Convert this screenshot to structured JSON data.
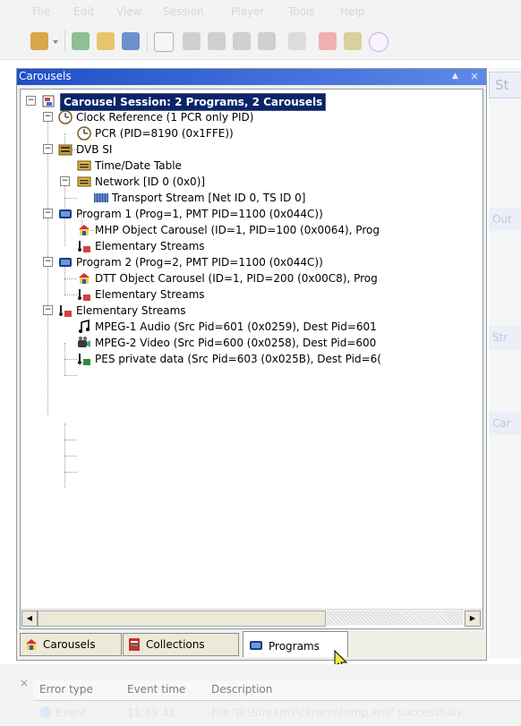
{
  "menu": [
    "File",
    "Edit",
    "View",
    "Session",
    "Player",
    "Tools",
    "Help"
  ],
  "toolbar": {
    "icons": [
      "new-carousel-icon",
      "dropdown-arrow-icon",
      "new-item-icon",
      "open-folder-icon",
      "save-icon",
      "window-icon",
      "play-icon",
      "pause-icon",
      "stop-icon",
      "record-icon",
      "settings-icon",
      "plugin-icon",
      "media-icon",
      "ts-icon"
    ]
  },
  "panel": {
    "title": "Carousels",
    "pin": "▲",
    "close": "×"
  },
  "tree": [
    {
      "label": "Carousel Session: 2 Programs, 2 Carousels",
      "icon": "session-icon",
      "level": 0,
      "expand": "−",
      "selected": true
    },
    {
      "label": "Clock Reference (1 PCR only PID)",
      "icon": "clock-icon",
      "level": 1,
      "expand": "−"
    },
    {
      "label": "PCR (PID=8190 (0x1FFE))",
      "icon": "clock-icon",
      "level": 2
    },
    {
      "label": "DVB SI",
      "icon": "dvb-si-icon",
      "level": 1,
      "expand": "−"
    },
    {
      "label": "Time/Date Table",
      "icon": "table-icon",
      "level": 2
    },
    {
      "label": "Network [ID 0 (0x0)]",
      "icon": "table-icon",
      "level": 2,
      "expand": "−"
    },
    {
      "label": "Transport Stream [Net ID 0, TS ID 0]",
      "icon": "transport-stream-icon",
      "level": 3
    },
    {
      "label": "Program 1 (Prog=1, PMT PID=1100 (0x044C))",
      "icon": "program-icon",
      "level": 1,
      "expand": "−"
    },
    {
      "label": "MHP Object Carousel (ID=1, PID=100 (0x0064), Prog",
      "icon": "carousel-icon",
      "level": 2
    },
    {
      "label": "Elementary Streams",
      "icon": "streams-icon",
      "level": 2
    },
    {
      "label": "Program 2 (Prog=2, PMT PID=1100 (0x044C))",
      "icon": "program-icon",
      "level": 1,
      "expand": "−"
    },
    {
      "label": "DTT Object Carousel (ID=1, PID=200 (0x00C8), Prog",
      "icon": "carousel-icon",
      "level": 2
    },
    {
      "label": "Elementary Streams",
      "icon": "streams-icon",
      "level": 2
    },
    {
      "label": "Elementary Streams",
      "icon": "streams-icon",
      "level": 1,
      "expand": "−"
    },
    {
      "label": "MPEG-1 Audio (Src Pid=601 (0x0259), Dest Pid=601",
      "icon": "audio-icon",
      "level": 2
    },
    {
      "label": "MPEG-2 Video (Src Pid=600 (0x0258), Dest Pid=600",
      "icon": "video-icon",
      "level": 2
    },
    {
      "label": "PES private data (Src Pid=603 (0x025B), Dest Pid=6(",
      "icon": "pes-data-icon",
      "level": 2
    }
  ],
  "scroll": {
    "left": "◀",
    "right": "▶"
  },
  "tabs": [
    {
      "label": "Carousels",
      "icon": "carousel-icon",
      "active": false
    },
    {
      "label": "Collections",
      "icon": "collections-icon",
      "active": false
    },
    {
      "label": "Programs",
      "icon": "program-icon",
      "active": true
    }
  ],
  "right_panel": {
    "title_fragment": "St",
    "sections": [
      "Out",
      "Str",
      "Car"
    ]
  },
  "log": {
    "close": "×",
    "columns": [
      "Error type",
      "Event time",
      "Description"
    ],
    "row": {
      "type": "Event",
      "time": "11:39:41",
      "desc": "File 'D:\\Streams\\carann\\temp.xml' successfully..."
    }
  }
}
